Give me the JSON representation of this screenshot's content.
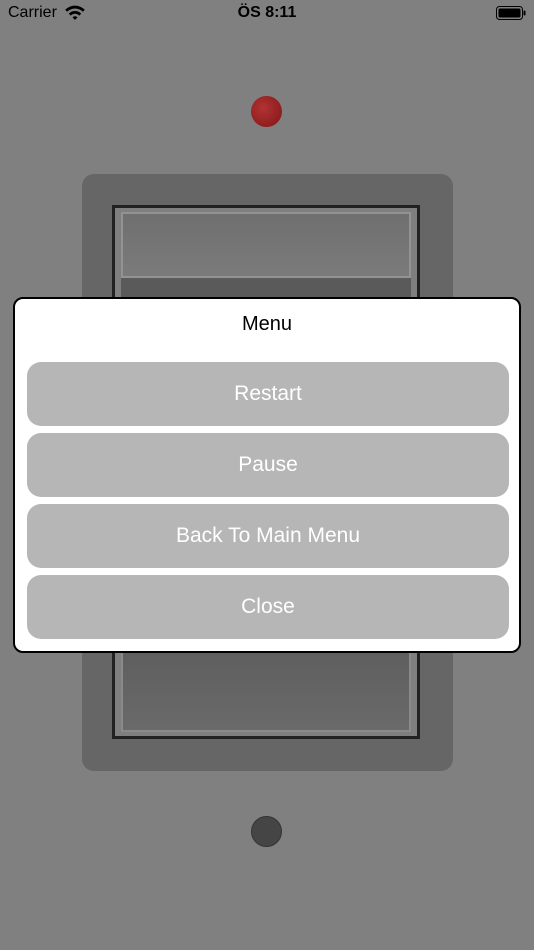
{
  "status_bar": {
    "carrier": "Carrier",
    "time": "ÖS 8:11",
    "wifi_icon": "wifi-icon",
    "battery_icon": "battery-icon"
  },
  "game": {
    "top_indicator_color": "#a52525",
    "bottom_indicator_color": "#454545"
  },
  "menu": {
    "title": "Menu",
    "restart_label": "Restart",
    "pause_label": "Pause",
    "back_label": "Back To Main Menu",
    "close_label": "Close"
  }
}
